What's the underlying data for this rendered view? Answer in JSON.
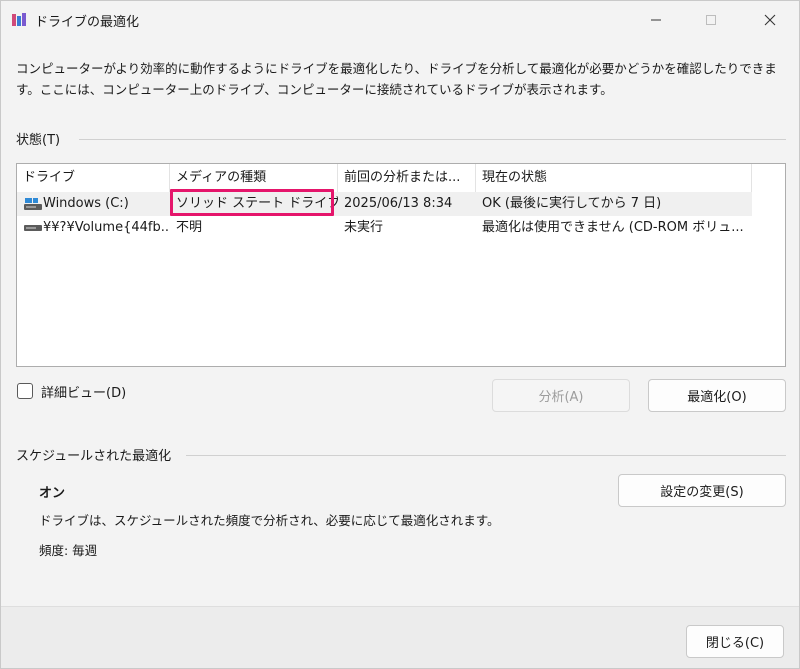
{
  "window": {
    "title": "ドライブの最適化",
    "icon": "defrag-app-icon"
  },
  "description": "コンピューターがより効率的に動作するようにドライブを最適化したり、ドライブを分析して最適化が必要かどうかを確認したりできます。ここには、コンピューター上のドライブ、コンピューターに接続されているドライブが表示されます。",
  "status_section": {
    "label": "状態(T)",
    "columns": [
      "ドライブ",
      "メディアの種類",
      "前回の分析または...",
      "現在の状態"
    ],
    "rows": [
      {
        "drive": "Windows (C:)",
        "icon": "system-drive-icon",
        "media": "ソリッド ステート ドライブ",
        "last": "2025/06/13 8:34",
        "status": "OK (最後に実行してから 7 日)",
        "selected": true
      },
      {
        "drive": "¥¥?¥Volume{44fb...",
        "icon": "volume-drive-icon",
        "media": "不明",
        "last": "未実行",
        "status": "最適化は使用できません (CD-ROM ボリュ...",
        "selected": false
      }
    ]
  },
  "detail_view": {
    "label": "詳細ビュー(D)",
    "checked": false
  },
  "buttons": {
    "analyze": "分析(A)",
    "optimize": "最適化(O)",
    "change_settings": "設定の変更(S)",
    "close": "閉じる(C)"
  },
  "schedule": {
    "label": "スケジュールされた最適化",
    "state": "オン",
    "description": "ドライブは、スケジュールされた頻度で分析され、必要に応じて最適化されます。",
    "frequency": "頻度: 毎週"
  },
  "colors": {
    "highlight": "#e5156b",
    "window_bg": "#f3f3f3"
  }
}
